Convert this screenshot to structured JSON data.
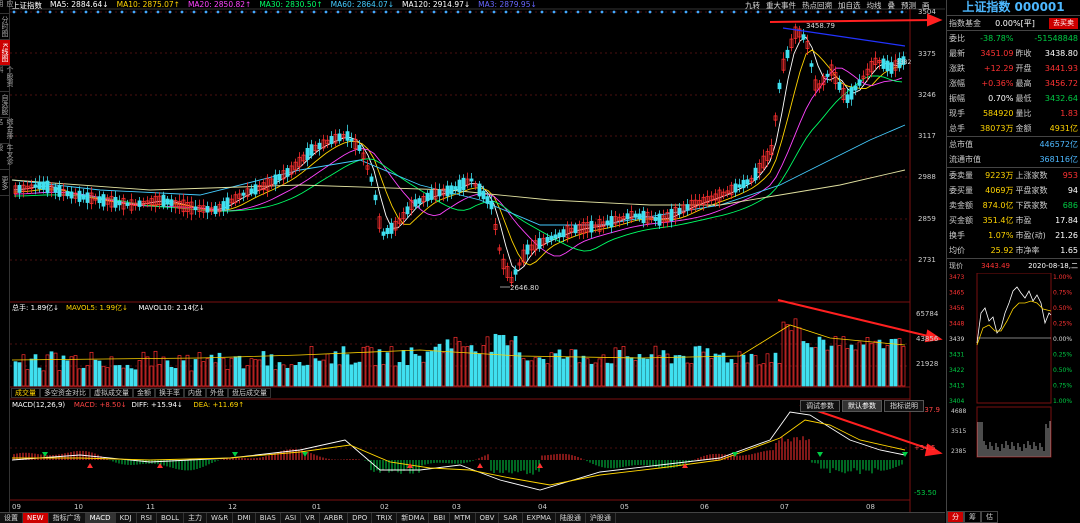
{
  "top": {
    "ma_items": [
      {
        "label": "上证指数",
        "color": "#ffffff"
      },
      {
        "label": "MA5: 2884.64↓",
        "color": "#ffffff"
      },
      {
        "label": "MA10: 2875.07↑",
        "color": "#ffd400"
      },
      {
        "label": "MA20: 2850.82↑",
        "color": "#ff44ff"
      },
      {
        "label": "MA30: 2830.50↑",
        "color": "#00ff66"
      },
      {
        "label": "MA60: 2864.07↓",
        "color": "#44ccff"
      },
      {
        "label": "MA120: 2914.97↓",
        "color": "#ffffff"
      },
      {
        "label": "MA3: 2879.95↓",
        "color": "#6666ff"
      }
    ],
    "tools": [
      "九转",
      "重大事件",
      "热点回溯",
      "加自选",
      "均线",
      "叠",
      "预测",
      "画"
    ]
  },
  "left_tabs": [
    {
      "label": "应用",
      "active": false
    },
    {
      "label": "分时图",
      "active": false
    },
    {
      "label": "K线图",
      "active": true
    },
    {
      "label": "个股资料",
      "active": false
    },
    {
      "label": "自选股",
      "active": false
    },
    {
      "label": "综合排名",
      "active": false
    },
    {
      "label": "牛叉诊股",
      "active": false
    },
    {
      "label": "更多",
      "active": false
    }
  ],
  "price_axis": [
    "3504",
    "3375",
    "3246",
    "3117",
    "2988",
    "2859",
    "2731"
  ],
  "price_annotations": {
    "high": "3458.79",
    "low": "2646.80",
    "mid": "3382"
  },
  "volume": {
    "legend": [
      {
        "label": "总手: 1.89亿↓",
        "color": "#ffffff"
      },
      {
        "label": "MAVOL5: 1.99亿↓",
        "color": "#ffd400"
      },
      {
        "label": "MAVOL10: 2.14亿↓",
        "color": "#ffffff"
      }
    ],
    "axis": [
      "65784",
      "43856",
      "21928"
    ]
  },
  "sub_tabs": [
    {
      "label": "成交量",
      "active": true
    },
    {
      "label": "多空资金对比",
      "active": false
    },
    {
      "label": "虚拟成交量",
      "active": false
    },
    {
      "label": "金额",
      "active": false
    },
    {
      "label": "换手率",
      "active": false
    },
    {
      "label": "内盘",
      "active": false
    },
    {
      "label": "外盘",
      "active": false
    },
    {
      "label": "盘后成交量",
      "active": false
    }
  ],
  "macd": {
    "legend": [
      {
        "label": "MACD(12,26,9)",
        "color": "#ffffff"
      },
      {
        "label": "MACD: +8.50↓",
        "color": "#ff4444"
      },
      {
        "label": "DIFF: +15.94↓",
        "color": "#ffffff"
      },
      {
        "label": "DEA: +11.69↑",
        "color": "#ffd400"
      }
    ],
    "axis": [
      "+137.9",
      "+54.5",
      "-53.50"
    ],
    "buttons": [
      {
        "label": "调试参数",
        "active": false
      },
      {
        "label": "默认参数",
        "active": true
      },
      {
        "label": "指标说明",
        "active": false
      }
    ]
  },
  "x_labels": [
    "09",
    "10",
    "11",
    "12",
    "01",
    "02",
    "03",
    "04",
    "05",
    "06",
    "07",
    "08"
  ],
  "bottom_tabs": [
    {
      "label": "设置",
      "type": "normal"
    },
    {
      "label": "NEW",
      "type": "new"
    },
    {
      "label": "指标广场",
      "type": "normal"
    },
    {
      "label": "MACD",
      "type": "active"
    },
    {
      "label": "KDJ",
      "type": "normal"
    },
    {
      "label": "RSI",
      "type": "normal"
    },
    {
      "label": "BOLL",
      "type": "normal"
    },
    {
      "label": "主力",
      "type": "normal"
    },
    {
      "label": "W&R",
      "type": "normal"
    },
    {
      "label": "DMI",
      "type": "normal"
    },
    {
      "label": "BIAS",
      "type": "normal"
    },
    {
      "label": "ASI",
      "type": "normal"
    },
    {
      "label": "VR",
      "type": "normal"
    },
    {
      "label": "ARBR",
      "type": "normal"
    },
    {
      "label": "DPO",
      "type": "normal"
    },
    {
      "label": "TRIX",
      "type": "normal"
    },
    {
      "label": "新DMA",
      "type": "normal"
    },
    {
      "label": "BBI",
      "type": "normal"
    },
    {
      "label": "MTM",
      "type": "normal"
    },
    {
      "label": "OBV",
      "type": "normal"
    },
    {
      "label": "SAR",
      "type": "normal"
    },
    {
      "label": "EXPMA",
      "type": "normal"
    },
    {
      "label": "陆股通",
      "type": "normal"
    },
    {
      "label": "沪股通",
      "type": "normal"
    }
  ],
  "panel": {
    "title": "上证指数 000001",
    "sub_left": "指数基金",
    "sub_mid": "0.00%[平]",
    "sub_btn": "去买卖",
    "rows_top": [
      {
        "l1": "委比",
        "v1": "-38.78%",
        "c1": "green",
        "l2": "",
        "v2": "-51548848",
        "c2": "green"
      },
      {
        "l1": "最新",
        "v1": "3451.09",
        "c1": "red",
        "l2": "昨收",
        "v2": "3438.80",
        "c2": "white"
      },
      {
        "l1": "涨跌",
        "v1": "+12.29",
        "c1": "red",
        "l2": "开盘",
        "v2": "3441.93",
        "c2": "red"
      },
      {
        "l1": "涨幅",
        "v1": "+0.36%",
        "c1": "red",
        "l2": "最高",
        "v2": "3456.72",
        "c2": "red"
      },
      {
        "l1": "振幅",
        "v1": "0.70%",
        "c1": "white",
        "l2": "最低",
        "v2": "3432.64",
        "c2": "green"
      },
      {
        "l1": "现手",
        "v1": "584920",
        "c1": "yellow",
        "l2": "量比",
        "v2": "1.83",
        "c2": "red"
      },
      {
        "l1": "总手",
        "v1": "38073万",
        "c1": "yellow",
        "l2": "金额",
        "v2": "4931亿",
        "c2": "yellow"
      }
    ],
    "rows_cap": [
      {
        "l": "总市值",
        "v": "446572亿",
        "c": "cyan"
      },
      {
        "l": "流通市值",
        "v": "368116亿",
        "c": "cyan"
      }
    ],
    "rows_bottom": [
      {
        "l1": "委卖量",
        "v1": "9223万",
        "c1": "yellow",
        "l2": "上涨家数",
        "v2": "953",
        "c2": "red"
      },
      {
        "l1": "委买量",
        "v1": "4069万",
        "c1": "yellow",
        "l2": "平盘家数",
        "v2": "94",
        "c2": "white"
      },
      {
        "l1": "卖金额",
        "v1": "874.0亿",
        "c1": "yellow",
        "l2": "下跌家数",
        "v2": "686",
        "c2": "green"
      },
      {
        "l1": "买金额",
        "v1": "351.4亿",
        "c1": "yellow",
        "l2": "市盈",
        "v2": "17.84",
        "c2": "white"
      },
      {
        "l1": "换手",
        "v1": "1.07%",
        "c1": "yellow",
        "l2": "市盈(动)",
        "v2": "21.26",
        "c2": "white"
      },
      {
        "l1": "均价",
        "v1": "25.92",
        "c1": "yellow",
        "l2": "市净率",
        "v2": "1.65",
        "c2": "white"
      }
    ],
    "mini": {
      "left_label": "现价",
      "price": "3443.49",
      "date": "2020-08-18,二",
      "left_axis": [
        "3473",
        "3465",
        "3456",
        "3448",
        "3439",
        "3431",
        "3422",
        "3413",
        "3404"
      ],
      "right_axis": [
        "1.00%",
        "0.75%",
        "0.50%",
        "0.25%",
        "0.00%",
        "0.25%",
        "0.50%",
        "0.75%",
        "1.00%"
      ],
      "vol_axis": [
        "4688",
        "3515",
        "2385"
      ],
      "tabs": [
        "分",
        "筹",
        "估"
      ]
    }
  }
}
